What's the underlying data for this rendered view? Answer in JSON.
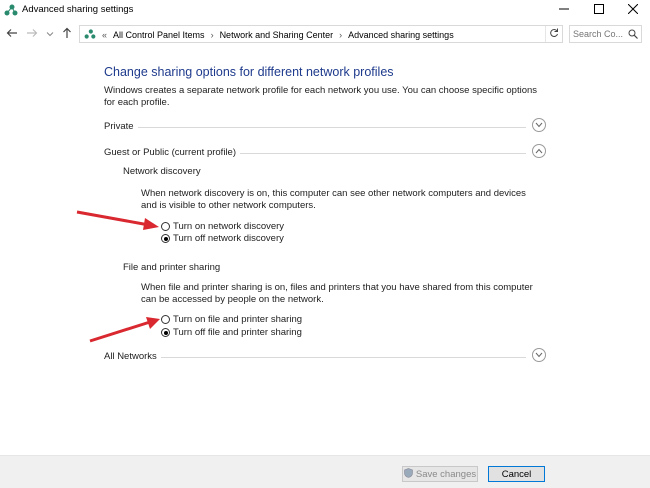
{
  "window": {
    "title": "Advanced sharing settings"
  },
  "address": {
    "prefix": "«",
    "crumbs": [
      "All Control Panel Items",
      "Network and Sharing Center",
      "Advanced sharing settings"
    ],
    "search_placeholder": "Search Co..."
  },
  "main": {
    "heading": "Change sharing options for different network profiles",
    "description": "Windows creates a separate network profile for each network you use. You can choose specific options for each profile.",
    "sections": {
      "private": "Private",
      "guest": "Guest or Public (current profile)",
      "all": "All Networks"
    },
    "network_discovery": {
      "title": "Network discovery",
      "desc": "When network discovery is on, this computer can see other network computers and devices and is visible to other network computers.",
      "on_label": "Turn on network discovery",
      "off_label": "Turn off network discovery",
      "selected": "off"
    },
    "file_sharing": {
      "title": "File and printer sharing",
      "desc": "When file and printer sharing is on, files and printers that you have shared from this computer can be accessed by people on the network.",
      "on_label": "Turn on file and printer sharing",
      "off_label": "Turn off file and printer sharing",
      "selected": "off"
    }
  },
  "footer": {
    "save_label": "Save changes",
    "cancel_label": "Cancel"
  },
  "colors": {
    "heading": "#1e3a8c",
    "annotation_arrow": "#d9282f",
    "cancel_border": "#0078d7"
  }
}
